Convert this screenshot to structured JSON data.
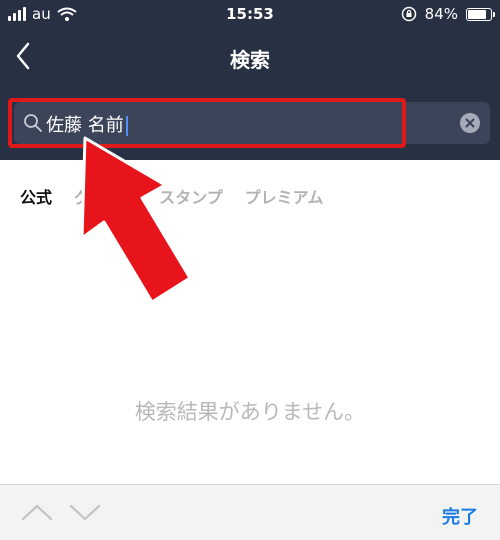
{
  "status_bar": {
    "carrier": "au",
    "time": "15:53",
    "battery_percent": "84%",
    "battery_level": 0.84
  },
  "nav": {
    "title": "検索",
    "back_icon": "chevron-left-icon"
  },
  "search": {
    "value": "佐藤 名前",
    "icon": "search-icon",
    "clear_icon": "clear-icon"
  },
  "tabs": [
    {
      "label": "公式",
      "active": true
    },
    {
      "label": "グループ"
    },
    {
      "label": "スタンプ"
    },
    {
      "label": "プレミアム"
    }
  ],
  "empty_message": "検索結果がありません。",
  "bottom_bar": {
    "done_label": "完了",
    "prev_icon": "chevron-up-icon",
    "next_icon": "chevron-down-icon"
  },
  "colors": {
    "header_bg": "#283044",
    "highlight": "#e01818",
    "accent": "#1a7be0"
  }
}
